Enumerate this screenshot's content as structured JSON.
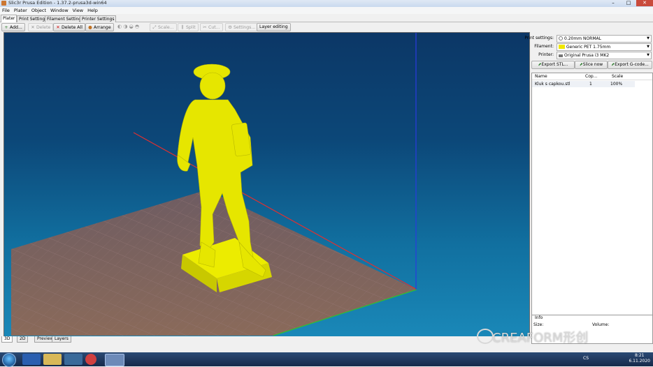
{
  "window": {
    "title": "Slic3r Prusa Edition - 1.37.2-prusa3d-win64",
    "controls": [
      "–",
      "□",
      "✕"
    ]
  },
  "menu": [
    "File",
    "Plater",
    "Object",
    "Window",
    "View",
    "Help"
  ],
  "tabs": [
    "Plater",
    "Print Settings",
    "Filament Settings",
    "Printer Settings"
  ],
  "toolbar": {
    "add": "Add...",
    "delete": "Delete",
    "delete_all": "Delete All",
    "arrange": "Arrange",
    "scale": "Scale...",
    "split": "Split",
    "cut": "Cut...",
    "settings": "Settings...",
    "layer_editing": "Layer editing"
  },
  "view_tabs": [
    "3D",
    "2D",
    "Preview",
    "Layers"
  ],
  "right_panel": {
    "print_settings_label": "Print settings:",
    "print_settings_value": "0.20mm NORMAL",
    "filament_label": "Filament:",
    "filament_value": "Generic PET 1.75mm",
    "filament_color": "#f0e800",
    "printer_label": "Printer:",
    "printer_value": "Original Prusa i3 MK2",
    "export_stl": "Export STL...",
    "slice_now": "Slice now",
    "export_gcode": "Export G-code..."
  },
  "object_list": {
    "columns": [
      "Name",
      "Cop...",
      "Scale"
    ],
    "rows": [
      {
        "name": "Kluk s capkou.stl",
        "copies": "1",
        "scale": "100%"
      }
    ]
  },
  "info": {
    "title": "Info",
    "size_label": "Size:",
    "volume_label": "Volume:"
  },
  "tray": {
    "lang": "CS",
    "time": "8:21",
    "date": "6.11.2020"
  },
  "watermark": "CREAFORM形创",
  "colors": {
    "model": "#e6e600",
    "bed": "#7a5a5a",
    "axis_x": "#e03030",
    "axis_y": "#30c030",
    "axis_z": "#2030d0"
  }
}
